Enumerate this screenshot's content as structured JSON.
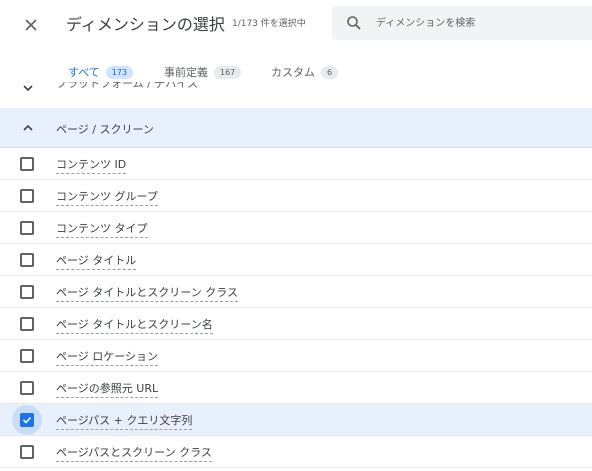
{
  "dialog": {
    "title": "ディメンションの選択",
    "selected_count": "1/173 件を選択中",
    "search_placeholder": "ディメンションを検索"
  },
  "tabs": [
    {
      "label": "すべて",
      "count": "173",
      "active": true
    },
    {
      "label": "事前定義",
      "count": "167",
      "active": false
    },
    {
      "label": "カスタム",
      "count": "6",
      "active": false
    }
  ],
  "groups": {
    "collapsed_above": "プラットフォーム / デバイス",
    "expanded": "ページ / スクリーン"
  },
  "items": [
    {
      "label": "コンテンツ ID",
      "checked": false
    },
    {
      "label": "コンテンツ グループ",
      "checked": false
    },
    {
      "label": "コンテンツ タイプ",
      "checked": false
    },
    {
      "label": "ページ タイトル",
      "checked": false
    },
    {
      "label": "ページ タイトルとスクリーン クラス",
      "checked": false
    },
    {
      "label": "ページ タイトルとスクリーン名",
      "checked": false
    },
    {
      "label": "ページ ロケーション",
      "checked": false
    },
    {
      "label": "ページの参照元 URL",
      "checked": false
    },
    {
      "label": "ページパス + クエリ文字列",
      "checked": true
    },
    {
      "label": "ページパスとスクリーン クラス",
      "checked": false
    }
  ],
  "colors": {
    "accent": "#1a73e8",
    "selected_bg": "#e8f0fe"
  }
}
